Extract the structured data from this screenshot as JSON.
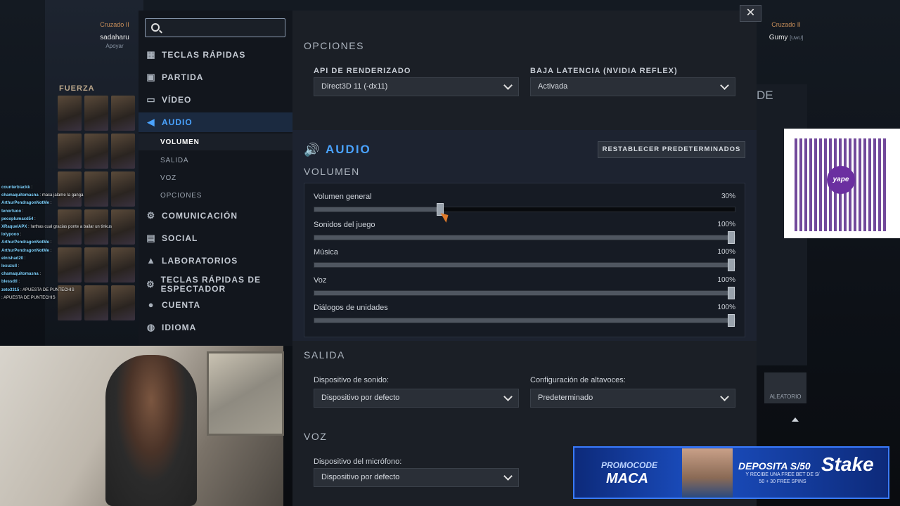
{
  "hud": {
    "left_rank": "Cruzado II",
    "left_player": "sadaharu",
    "left_sub": "Apoyar",
    "right_rank": "Cruzado II",
    "right_player": "Gumy",
    "right_tag": "[UwU]",
    "section_fuerza": "FUERZA",
    "right_partial": "DE",
    "random_label": "ALEATORIO"
  },
  "chat": [
    {
      "user": "counterblackk",
      "msg": ""
    },
    {
      "user": "chamaquitomasna",
      "msg": "maca jalame la ganga"
    },
    {
      "user": "ArthurPendragonNotMe",
      "msg": ""
    },
    {
      "user": "tenortuoo",
      "msg": ""
    },
    {
      "user": "pecoplumaxd54",
      "msg": ""
    },
    {
      "user": "XRaquelAPX",
      "msg": "!arthas cual gracias ponte a bailar un tinkus"
    },
    {
      "user": "lolypooo",
      "msg": ""
    },
    {
      "user": "ArthurPendragonNotMe",
      "msg": ""
    },
    {
      "user": "ArthurPendragonNotMe",
      "msg": ""
    },
    {
      "user": "elnishad20",
      "msg": ""
    },
    {
      "user": "lexuzull",
      "msg": ""
    },
    {
      "user": "chamaquitomasna",
      "msg": ""
    },
    {
      "user": "blessdtl",
      "msg": ""
    },
    {
      "user": "zeto3315",
      "msg": "APUESTA DE PUNTECHIS"
    },
    {
      "user": "",
      "msg": "APUESTA DE PUNTECHIS"
    }
  ],
  "search": {
    "placeholder": "",
    "value": ""
  },
  "menu": {
    "items": [
      {
        "label": "TECLAS RÁPIDAS",
        "icon": "grid-icon"
      },
      {
        "label": "PARTIDA",
        "icon": "game-icon"
      },
      {
        "label": "VÍDEO",
        "icon": "monitor-icon"
      },
      {
        "label": "AUDIO",
        "icon": "speaker-icon"
      },
      {
        "label": "COMUNICACIÓN",
        "icon": "gear-icon"
      },
      {
        "label": "SOCIAL",
        "icon": "chat-icon"
      },
      {
        "label": "LABORATORIOS",
        "icon": "flask-icon"
      },
      {
        "label": "TECLAS RÁPIDAS DE ESPECTADOR",
        "icon": "spectator-icon"
      },
      {
        "label": "CUENTA",
        "icon": "user-icon"
      },
      {
        "label": "IDIOMA",
        "icon": "globe-icon"
      }
    ],
    "audio_sub": [
      "VOLUMEN",
      "SALIDA",
      "VOZ",
      "OPCIONES"
    ],
    "active_color": "#4aa3ff"
  },
  "options": {
    "title": "OPCIONES",
    "render_api_label": "API DE RENDERIZADO",
    "render_api_value": "Direct3D 11 (-dx11)",
    "low_latency_label": "BAJA LATENCIA (NVIDIA REFLEX)",
    "low_latency_value": "Activada"
  },
  "audio": {
    "title": "AUDIO",
    "reset_label": "RESTABLECER PREDETERMINADOS",
    "volume_title": "VOLUMEN",
    "sliders": [
      {
        "label": "Volumen general",
        "value": 30,
        "display": "30%"
      },
      {
        "label": "Sonidos del juego",
        "value": 100,
        "display": "100%"
      },
      {
        "label": "Música",
        "value": 100,
        "display": "100%"
      },
      {
        "label": "Voz",
        "value": 100,
        "display": "100%"
      },
      {
        "label": "Diálogos de unidades",
        "value": 100,
        "display": "100%"
      }
    ],
    "output_title": "SALIDA",
    "sound_device_label": "Dispositivo de sonido:",
    "sound_device_value": "Dispositivo por defecto",
    "speaker_config_label": "Configuración de altavoces:",
    "speaker_config_value": "Predeterminado",
    "voice_title": "VOZ",
    "mic_label": "Dispositivo del micrófono:",
    "mic_value": "Dispositivo por defecto"
  },
  "qr": {
    "logo_text": "yape"
  },
  "promo": {
    "code_label": "PROMOCODE",
    "code": "MACA",
    "deposit": "DEPOSITA S/50",
    "sub": "Y RECIBE UNA FREE BET DE S/ 50 + 30 FREE SPINS",
    "brand": "Stake"
  }
}
